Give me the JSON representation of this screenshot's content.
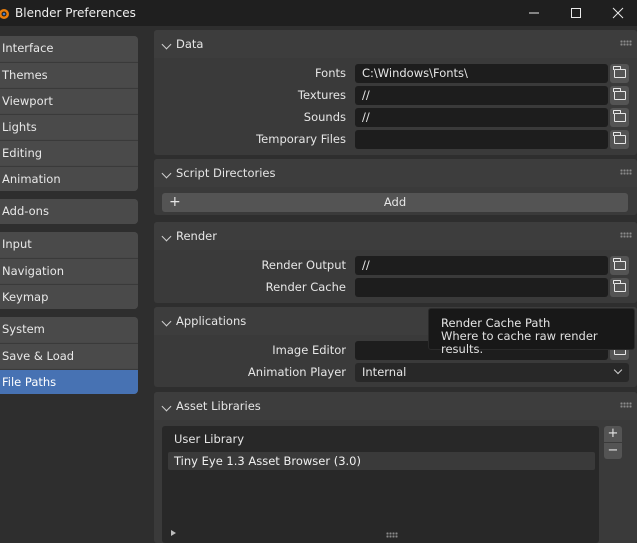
{
  "window": {
    "title": "Blender Preferences",
    "controls": [
      "minimize",
      "maximize",
      "close"
    ]
  },
  "sidebar": {
    "groups": [
      [
        "Interface",
        "Themes",
        "Viewport",
        "Lights",
        "Editing",
        "Animation"
      ],
      [
        "Add-ons"
      ],
      [
        "Input",
        "Navigation",
        "Keymap"
      ],
      [
        "System",
        "Save & Load",
        "File Paths"
      ]
    ],
    "active": "File Paths"
  },
  "data_panel": {
    "title": "Data",
    "rows": [
      {
        "label": "Fonts",
        "value": "C:\\Windows\\Fonts\\"
      },
      {
        "label": "Textures",
        "value": "//"
      },
      {
        "label": "Sounds",
        "value": "//"
      },
      {
        "label": "Temporary Files",
        "value": ""
      }
    ]
  },
  "script_panel": {
    "title": "Script Directories",
    "add_label": "Add"
  },
  "render_panel": {
    "title": "Render",
    "rows": [
      {
        "label": "Render Output",
        "value": "//"
      },
      {
        "label": "Render Cache",
        "value": ""
      }
    ]
  },
  "applications_panel": {
    "title": "Applications",
    "image_editor_label": "Image Editor",
    "image_editor_value": "",
    "animation_player_label": "Animation Player",
    "animation_player_value": "Internal"
  },
  "asset_panel": {
    "title": "Asset Libraries",
    "list_header": "User Library",
    "items": [
      "Tiny Eye 1.3 Asset Browser (3.0)"
    ],
    "add_symbol": "+",
    "remove_symbol": "−"
  },
  "tooltip": {
    "title": "Render Cache Path",
    "description": "Where to cache raw render results."
  },
  "icons": {
    "logo": "blender-logo-icon",
    "folder": "folder-icon",
    "menu": "hamburger-icon"
  },
  "colors": {
    "accent": "#4772b3",
    "background": "#2e2e2e",
    "panel": "#3a3a3a",
    "field": "#1d1d1d"
  }
}
